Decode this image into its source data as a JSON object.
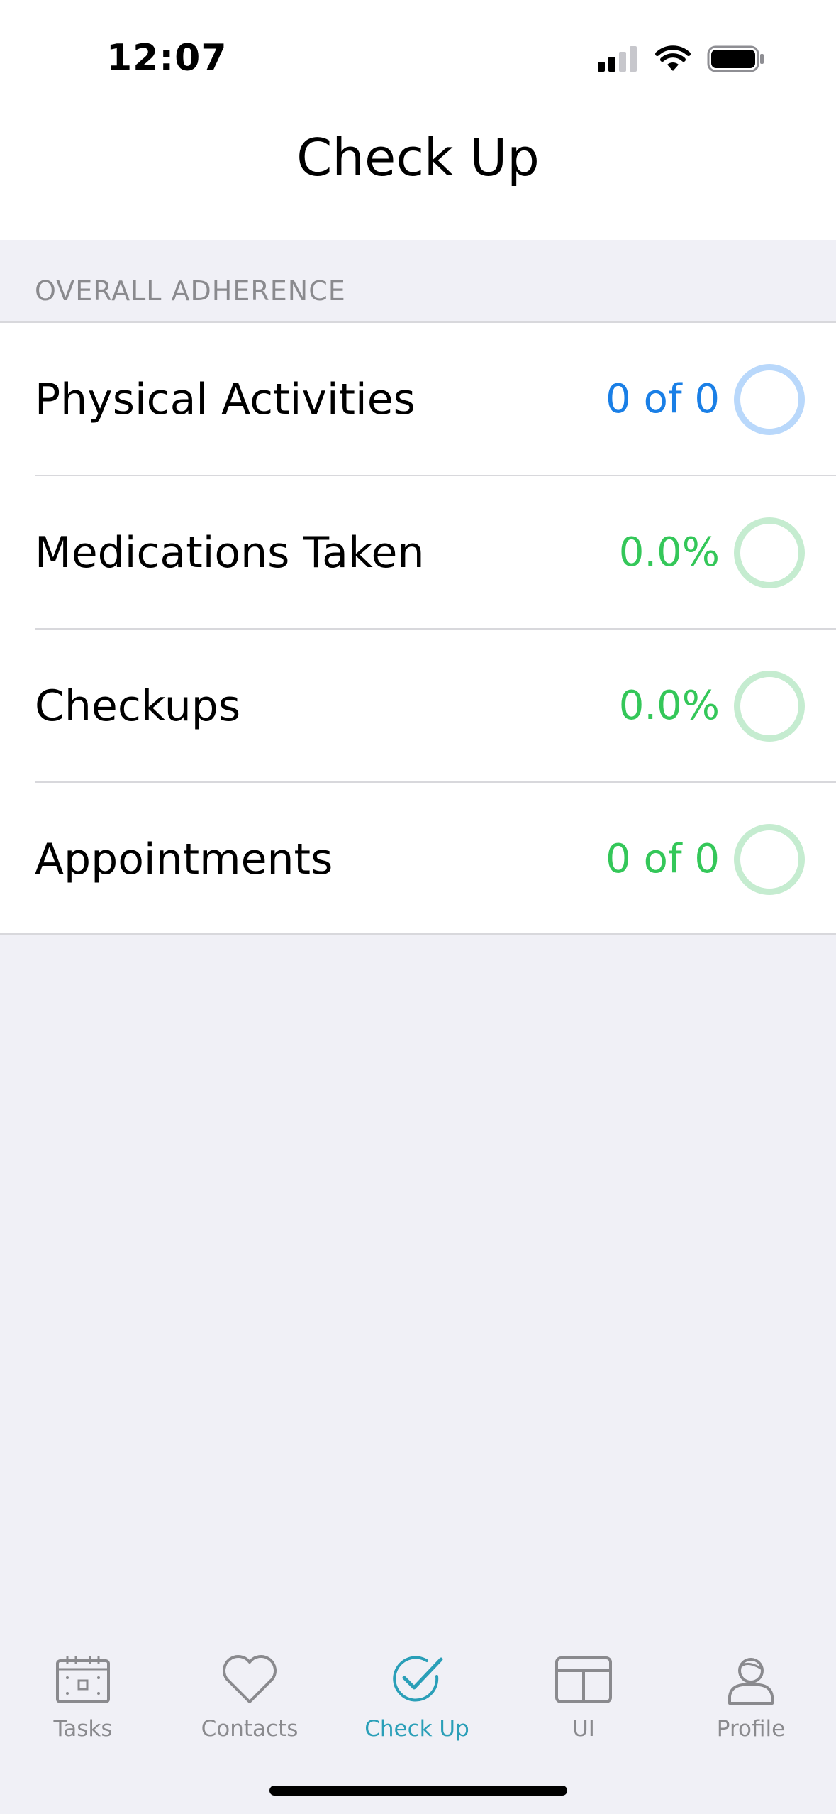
{
  "status_bar": {
    "time": "12:07",
    "icons": [
      "cellular-signal-icon",
      "wifi-icon",
      "battery-icon"
    ]
  },
  "nav": {
    "title": "Check Up"
  },
  "section": {
    "header": "OVERALL ADHERENCE"
  },
  "rows": [
    {
      "label": "Physical Activities",
      "value": "0 of 0",
      "color": "#1a7fe6",
      "ring_color": "#b9d8fb",
      "progress": 0
    },
    {
      "label": "Medications Taken",
      "value": "0.0%",
      "color": "#34c759",
      "ring_color": "#c5ecd0",
      "progress": 0
    },
    {
      "label": "Checkups",
      "value": "0.0%",
      "color": "#34c759",
      "ring_color": "#c5ecd0",
      "progress": 0
    },
    {
      "label": "Appointments",
      "value": "0 of 0",
      "color": "#34c759",
      "ring_color": "#c5ecd0",
      "progress": 0
    }
  ],
  "tabs": [
    {
      "label": "Tasks",
      "icon": "calendar-icon",
      "active": false
    },
    {
      "label": "Contacts",
      "icon": "heart-icon",
      "active": false
    },
    {
      "label": "Check Up",
      "icon": "checkmark-circle-icon",
      "active": true
    },
    {
      "label": "UI",
      "icon": "layout-icon",
      "active": false
    },
    {
      "label": "Profile",
      "icon": "person-icon",
      "active": false
    }
  ],
  "colors": {
    "accent": "#2a9fb8",
    "inactive": "#8a8a8e",
    "background": "#f0f0f6"
  }
}
